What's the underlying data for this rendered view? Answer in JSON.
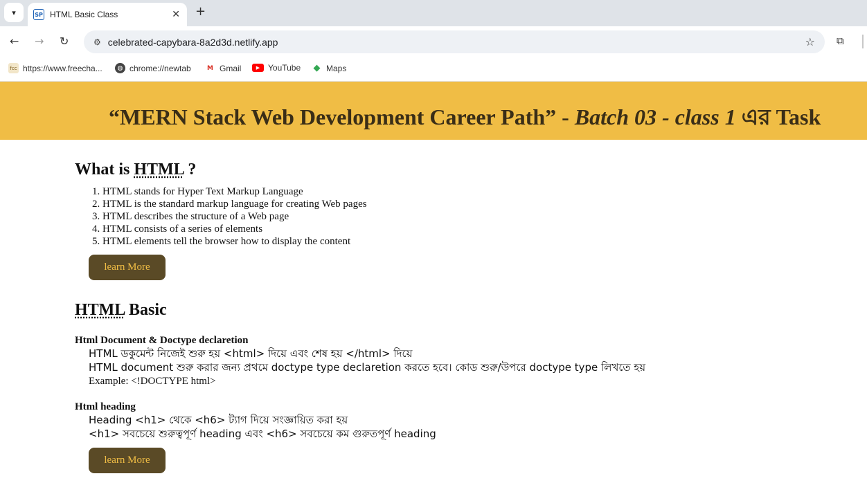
{
  "browser": {
    "tab_title": "HTML Basic Class",
    "tab_favicon": "SP",
    "url": "celebrated-capybara-8a2d3d.netlify.app",
    "bookmarks": [
      {
        "label": "https://www.freecha...",
        "icon": "fcc-icon"
      },
      {
        "label": "chrome://newtab",
        "icon": "globe-icon"
      },
      {
        "label": "Gmail",
        "icon": "gmail-icon"
      },
      {
        "label": "YouTube",
        "icon": "youtube-icon"
      },
      {
        "label": "Maps",
        "icon": "maps-icon"
      }
    ]
  },
  "banner": {
    "quote_part": "“MERN Stack Web Development Career Path”",
    "separator1": " - ",
    "batch": "Batch 03 - class 1",
    "suffix": " এর Task",
    "background": "#f0bd45"
  },
  "section1": {
    "heading_prefix": "What is ",
    "heading_abbr": "HTML",
    "heading_suffix": " ?",
    "items": [
      "HTML stands for Hyper Text Markup Language",
      "HTML is the standard markup language for creating Web pages",
      "HTML describes the structure of a Web page",
      "HTML consists of a series of elements",
      "HTML elements tell the browser how to display the content"
    ],
    "button": "learn More"
  },
  "section2": {
    "heading_abbr": "HTML",
    "heading_suffix": " Basic",
    "doctype": {
      "title": "Html Document & Doctype declaretion",
      "lines": [
        "HTML ডকুমেন্ট নিজেই শুরু হয় <html> দিয়ে এবং শেষ হয় </html> দিয়ে",
        "HTML document শুরু করার জন্য প্রথমে doctype type declaretion করতে হবে। কোড শুরু/উপরে doctype type লিখতে হয়",
        "Example: <!DOCTYPE html>"
      ]
    },
    "heading": {
      "title": "Html heading",
      "lines": [
        "Heading <h1> থেকে <h6> ট্যাগ দিয়ে সংজ্ঞায়িত করা হয়",
        "<h1> সবচেয়ে শুরুত্বপূর্ণ heading এবং <h6> সবচেয়ে কম গুরুতপূর্ণ heading"
      ]
    },
    "button": "learn More"
  },
  "colors": {
    "button_bg": "#5a4a26",
    "button_text": "#f0bd45"
  }
}
